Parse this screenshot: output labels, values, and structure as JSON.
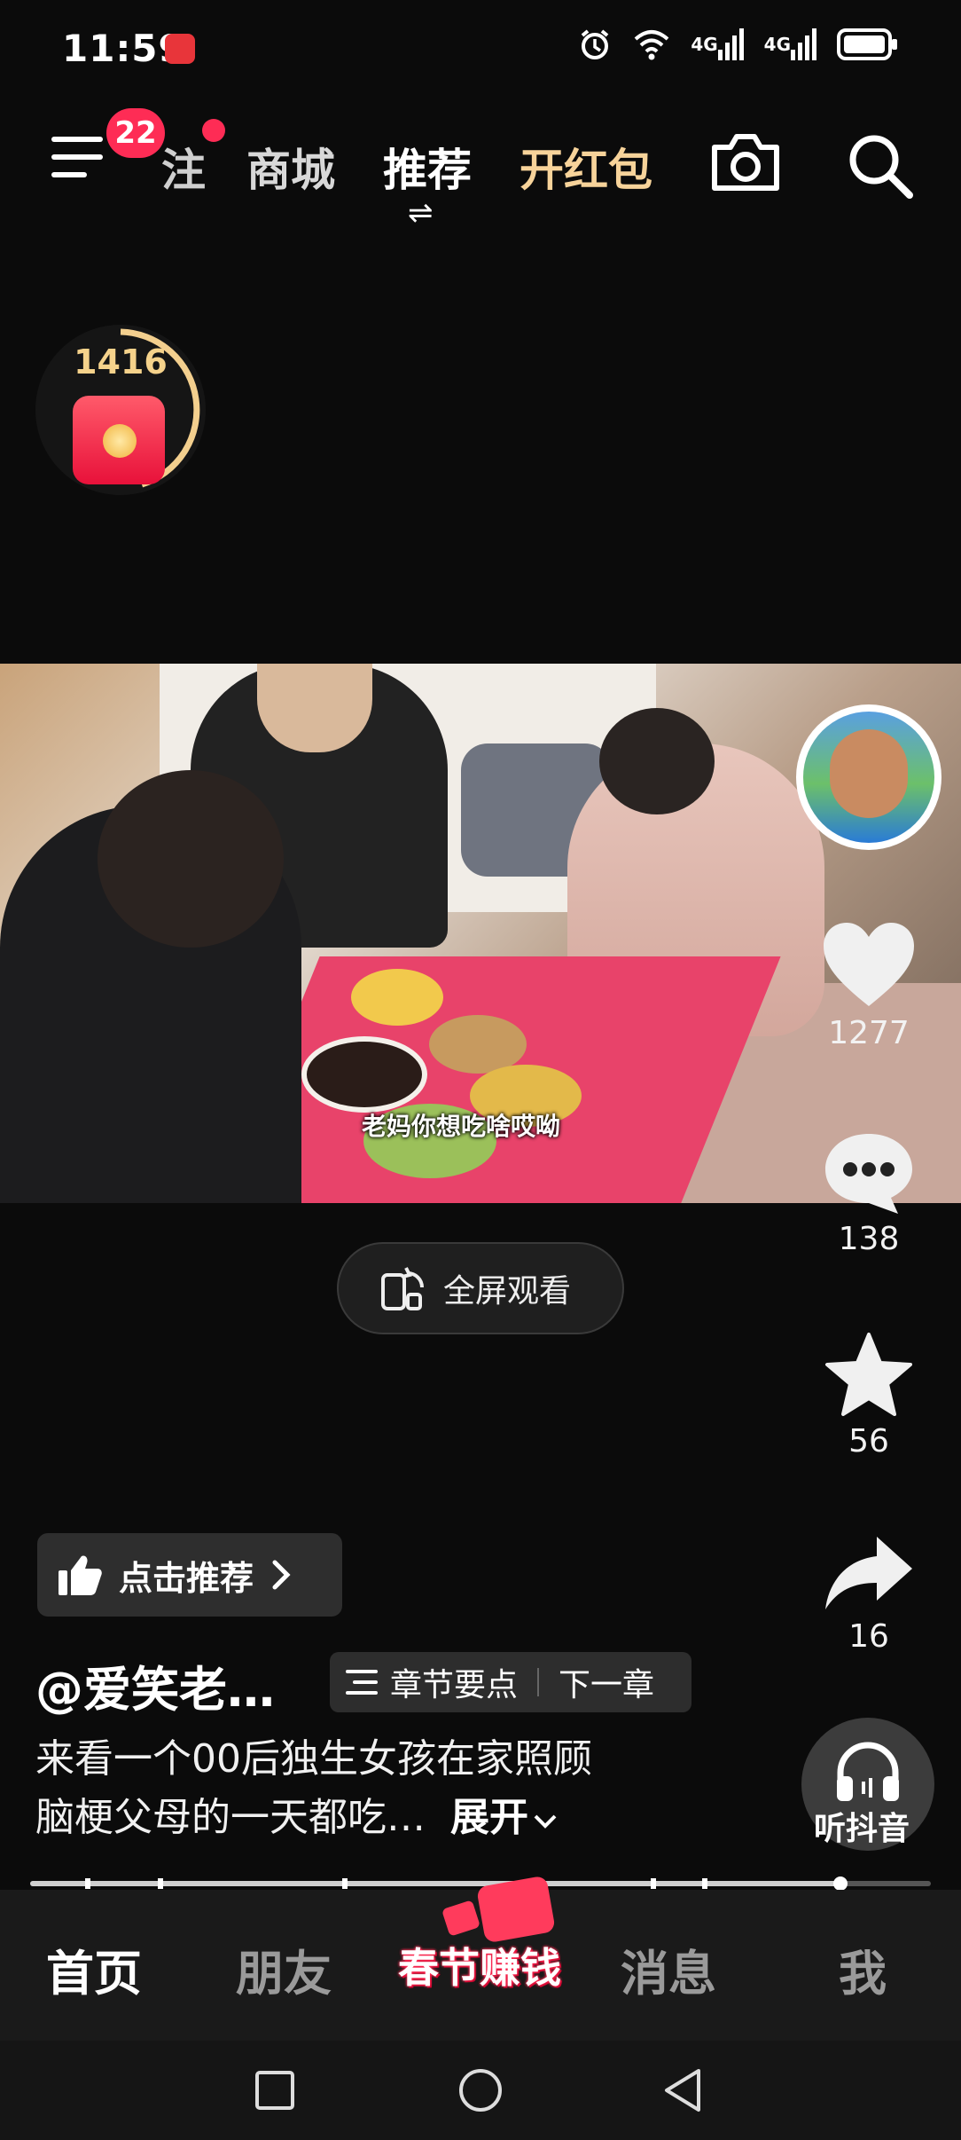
{
  "status_bar": {
    "time": "11:59",
    "net1": "4G",
    "net2": "4G"
  },
  "top_nav": {
    "badge_count": "22",
    "tabs": [
      "注",
      "商城",
      "推荐",
      "开红包"
    ],
    "active_swap": "⇌"
  },
  "redpack": {
    "count": "1416"
  },
  "video": {
    "caption": "老妈你想吃啥哎呦"
  },
  "actions": {
    "likes": "1277",
    "comments": "138",
    "favorites": "56",
    "shares": "16"
  },
  "fullscreen": {
    "label": "全屏观看"
  },
  "recommend": {
    "label": "点击推荐"
  },
  "post": {
    "author": "@爱笑老…",
    "chapter_label": "章节要点",
    "next_chapter": "下一章",
    "desc_line1": "来看一个00后独生女孩在家照顾",
    "desc_line2": "脑梗父母的一天都吃…",
    "expand": "展开"
  },
  "listen": {
    "label": "听抖音"
  },
  "progress": {
    "value": 0.9
  },
  "bottom_nav": {
    "home": "首页",
    "friends": "朋友",
    "center": "春节赚钱",
    "messages": "消息",
    "me": "我"
  },
  "colors": {
    "accent": "#fe2c55",
    "hongbao_gold": "#f7d39a"
  }
}
